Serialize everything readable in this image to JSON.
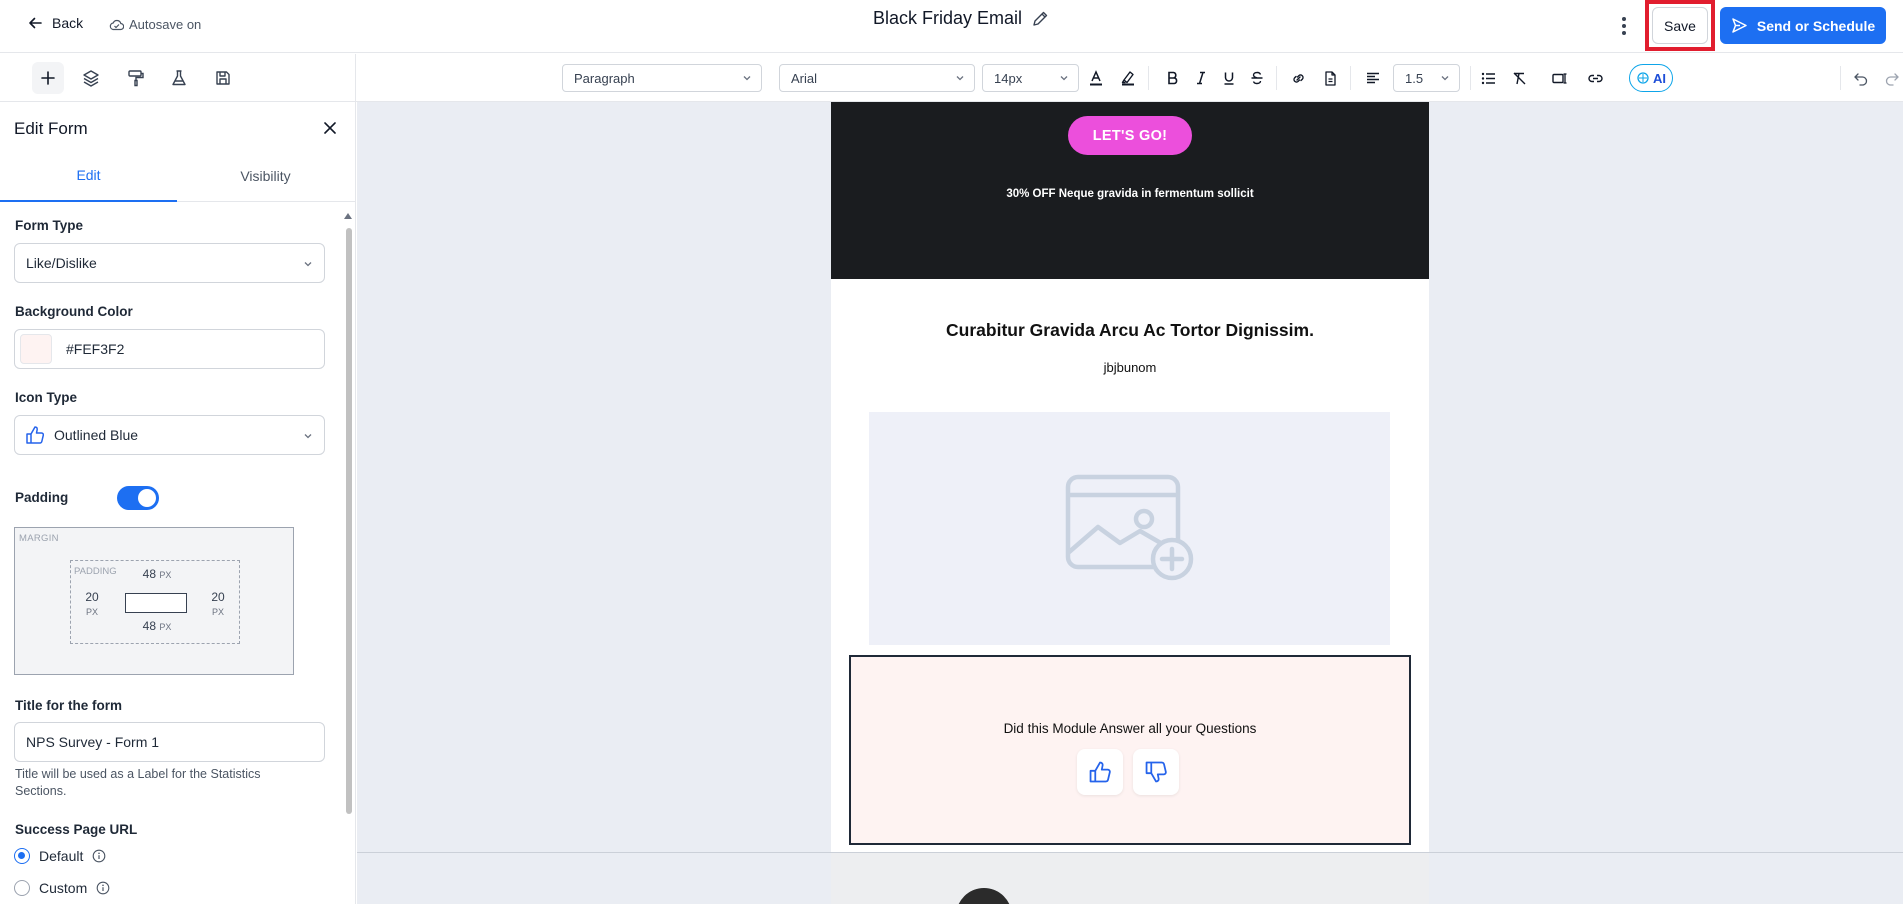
{
  "header": {
    "back_label": "Back",
    "autosave_label": "Autosave on",
    "doc_title": "Black Friday Email",
    "save_label": "Save",
    "send_label": "Send or Schedule",
    "accent": "#1d6ff2",
    "highlight": "#e11d2e"
  },
  "toolbar": {
    "block_style": "Paragraph",
    "font_family": "Arial",
    "font_size": "14px",
    "line_height": "1.5",
    "ai_label": "AI"
  },
  "sidebar": {
    "title": "Edit Form",
    "tabs": [
      {
        "label": "Edit",
        "active": true
      },
      {
        "label": "Visibility",
        "active": false
      }
    ],
    "form_type_label": "Form Type",
    "form_type_value": "Like/Dislike",
    "bg_color_label": "Background Color",
    "bg_color_value": "#FEF3F2",
    "icon_type_label": "Icon Type",
    "icon_type_value": "Outlined Blue",
    "padding_label": "Padding",
    "padding_enabled": true,
    "box_model": {
      "margin_label": "MARGIN",
      "padding_label": "PADDING",
      "top": "48",
      "bottom": "48",
      "left": "20",
      "right": "20",
      "unit": "PX"
    },
    "form_title_label": "Title for the form",
    "form_title_value": "NPS Survey - Form 1",
    "form_title_help": "Title will be used as a Label for the Statistics Sections.",
    "success_url_label": "Success Page URL",
    "success_options": [
      {
        "label": "Default",
        "selected": true
      },
      {
        "label": "Custom",
        "selected": false
      }
    ]
  },
  "email": {
    "cta_label": "LET'S GO!",
    "promo_text": "30% OFF Neque gravida in fermentum sollicit",
    "heading": "Curabitur Gravida Arcu Ac Tortor Dignissim.",
    "subtext": "jbjbunom",
    "form_question": "Did this Module Answer all your Questions",
    "hero_bg": "#1a1c1f",
    "cta_color": "#ec4fdc"
  }
}
